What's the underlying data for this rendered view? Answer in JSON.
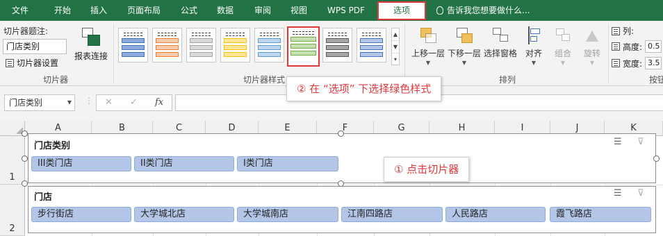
{
  "menu": {
    "items": [
      "文件",
      "开始",
      "插入",
      "页面布局",
      "公式",
      "数据",
      "审阅",
      "视图",
      "WPS PDF",
      "选项"
    ],
    "active": "选项",
    "tell_me": "告诉我您想要做什么..."
  },
  "ribbon": {
    "slicer_group": {
      "caption_label": "切片器题注:",
      "caption_value": "门店类别",
      "settings_label": "切片器设置",
      "report_connections_label": "报表连接",
      "group_label": "切片器"
    },
    "styles_group": {
      "group_label": "切片器样式",
      "styles": [
        {
          "name": "blue-dark",
          "bar": "#8ea9db",
          "border": "#4472c4"
        },
        {
          "name": "orange",
          "bar": "#f8cbad",
          "border": "#ed7d31"
        },
        {
          "name": "gray",
          "bar": "#d9d9d9",
          "border": "#a5a5a5"
        },
        {
          "name": "gold",
          "bar": "#ffe699",
          "border": "#ffc000"
        },
        {
          "name": "blue",
          "bar": "#bdd7ee",
          "border": "#5b9bd5"
        },
        {
          "name": "green",
          "bar": "#c6e0b4",
          "border": "#70ad47"
        },
        {
          "name": "dark",
          "bar": "#a6a6a6",
          "border": "#595959"
        },
        {
          "name": "navy",
          "bar": "#b4c6e7",
          "border": "#4472c4"
        }
      ],
      "selected_style": "green"
    },
    "arrange_group": {
      "group_label": "排列",
      "buttons": {
        "bring_forward": "上移一层",
        "send_backward": "下移一层",
        "selection_pane": "选择窗格",
        "align": "对齐",
        "group": "组合",
        "rotate": "旋转"
      }
    },
    "size_group": {
      "columns_label": "列:",
      "height_label": "高度:",
      "height_value": "0.5",
      "width_label": "宽度:",
      "width_value": "3.5",
      "group_label_partial": "按钮"
    }
  },
  "formula_bar": {
    "name_box": "门店类别",
    "cancel": "✕",
    "enter": "✓",
    "fx": "fx"
  },
  "grid": {
    "columns": [
      "A",
      "B",
      "C",
      "D",
      "E",
      "F",
      "G",
      "H",
      "I",
      "J",
      "K"
    ],
    "rows": [
      "1",
      "2"
    ]
  },
  "slicers": [
    {
      "title": "门店类别",
      "items": [
        "III类门店",
        "II类门店",
        "I类门店"
      ]
    },
    {
      "title": "门店",
      "items": [
        "步行街店",
        "大学城北店",
        "大学城南店",
        "江南四路店",
        "人民路店",
        "霞飞路店"
      ]
    }
  ],
  "annotations": {
    "step1": "① 点击切片器",
    "step2": "② 在 “选项” 下选择绿色样式"
  },
  "colors": {
    "ribbon_green": "#217346",
    "highlight_red": "#e0383b",
    "slicer_item_fill": "#b4c6e7"
  }
}
